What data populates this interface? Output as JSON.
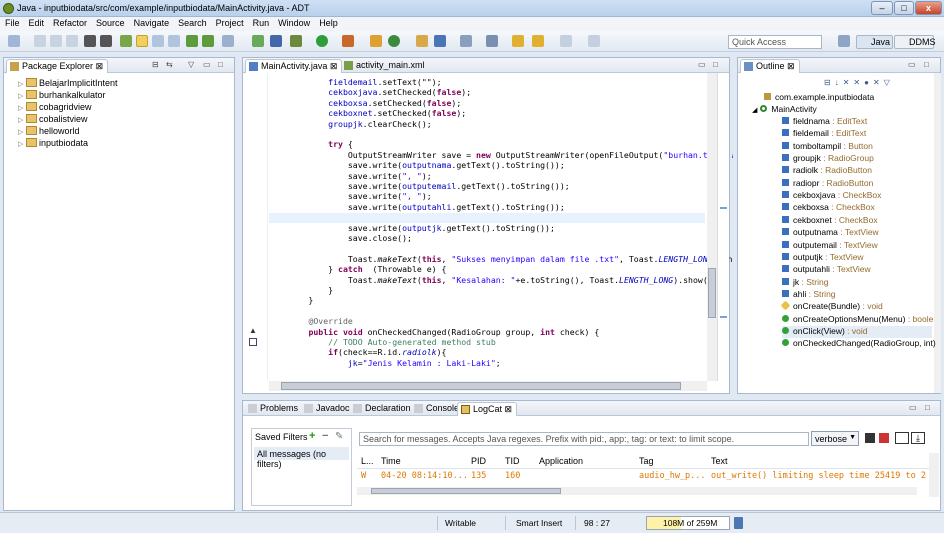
{
  "window": {
    "title": "Java - inputbiodata/src/com/example/inputbiodata/MainActivity.java - ADT",
    "min": "–",
    "max": "□",
    "close": "x"
  },
  "menu": [
    "File",
    "Edit",
    "Refactor",
    "Source",
    "Navigate",
    "Search",
    "Project",
    "Run",
    "Window",
    "Help"
  ],
  "toolbar": {
    "quick_access_placeholder": "Quick Access",
    "java_perspective": "Java",
    "ddms_perspective": "DDMS"
  },
  "package_explorer": {
    "tab": "Package Explorer",
    "projects": [
      "BelajarImplicitIntent",
      "burhankalkulator",
      "cobagridview",
      "cobalistview",
      "helloworld",
      "inputbiodata"
    ]
  },
  "editor": {
    "tabs": [
      "MainActivity.java",
      "activity_main.xml"
    ],
    "lines": [
      [
        [
          "",
          "            "
        ],
        [
          "fld",
          "fieldemail"
        ],
        [
          "",
          ".setText(\"\");"
        ]
      ],
      [
        [
          "",
          "            "
        ],
        [
          "fld",
          "cekboxjava"
        ],
        [
          "",
          ".setChecked("
        ],
        [
          "kw",
          "false"
        ],
        [
          "",
          ");"
        ]
      ],
      [
        [
          "",
          "            "
        ],
        [
          "fld",
          "cekboxsa"
        ],
        [
          "",
          ".setChecked("
        ],
        [
          "kw",
          "false"
        ],
        [
          "",
          ");"
        ]
      ],
      [
        [
          "",
          "            "
        ],
        [
          "fld",
          "cekboxnet"
        ],
        [
          "",
          ".setChecked("
        ],
        [
          "kw",
          "false"
        ],
        [
          "",
          ");"
        ]
      ],
      [
        [
          "",
          "            "
        ],
        [
          "fld",
          "groupjk"
        ],
        [
          "",
          ".clearCheck();"
        ]
      ],
      [
        [
          "",
          ""
        ]
      ],
      [
        [
          "",
          "            "
        ],
        [
          "kw",
          "try"
        ],
        [
          "",
          " {"
        ]
      ],
      [
        [
          "",
          "                OutputStreamWriter save = "
        ],
        [
          "kw",
          "new"
        ],
        [
          "",
          " OutputStreamWriter(openFileOutput("
        ],
        [
          "str",
          "\"burhan.txt\""
        ],
        [
          "",
          ", "
        ],
        [
          "fld ital",
          "M"
        ]
      ],
      [
        [
          "",
          "                save.write("
        ],
        [
          "fld",
          "outputnama"
        ],
        [
          "",
          ".getText().toString());"
        ]
      ],
      [
        [
          "",
          "                save.write("
        ],
        [
          "str",
          "\", \""
        ],
        [
          "",
          ");"
        ]
      ],
      [
        [
          "",
          "                save.write("
        ],
        [
          "fld",
          "outputemail"
        ],
        [
          "",
          ".getText().toString());"
        ]
      ],
      [
        [
          "",
          "                save.write("
        ],
        [
          "str",
          "\", \""
        ],
        [
          "",
          ");"
        ]
      ],
      [
        [
          "",
          "                save.write("
        ],
        [
          "fld",
          "outputahli"
        ],
        [
          "",
          ".getText().toString());"
        ]
      ],
      [
        [
          "",
          "                save.write("
        ],
        [
          "str",
          "\", \""
        ],
        [
          "",
          ");"
        ]
      ],
      [
        [
          "",
          "                save.write("
        ],
        [
          "fld",
          "outputjk"
        ],
        [
          "",
          ".getText().toString());"
        ]
      ],
      [
        [
          "",
          "                save.close();"
        ]
      ],
      [
        [
          "",
          ""
        ]
      ],
      [
        [
          "",
          "                Toast."
        ],
        [
          "ital",
          "makeText"
        ],
        [
          "",
          "("
        ],
        [
          "kw",
          "this"
        ],
        [
          "",
          ", "
        ],
        [
          "str",
          "\"Sukses menyimpan dalam file .txt\""
        ],
        [
          "",
          ", Toast."
        ],
        [
          "fld ital",
          "LENGTH_LONG"
        ],
        [
          "",
          ").sho"
        ]
      ],
      [
        [
          "",
          "            } "
        ],
        [
          "kw",
          "catch"
        ],
        [
          "",
          "  (Throwable e) {"
        ]
      ],
      [
        [
          "",
          "                Toast."
        ],
        [
          "ital",
          "makeText"
        ],
        [
          "",
          "("
        ],
        [
          "kw",
          "this"
        ],
        [
          "",
          ", "
        ],
        [
          "str",
          "\"Kesalahan: \""
        ],
        [
          "",
          "+e.toString(), Toast."
        ],
        [
          "fld ital",
          "LENGTH_LONG"
        ],
        [
          "",
          ").show();"
        ]
      ],
      [
        [
          "",
          "            }"
        ]
      ],
      [
        [
          "",
          "        }"
        ]
      ],
      [
        [
          "",
          ""
        ]
      ],
      [
        [
          "",
          "        "
        ],
        [
          "ann",
          "@Override"
        ]
      ],
      [
        [
          "",
          "        "
        ],
        [
          "kw",
          "public"
        ],
        [
          "",
          " "
        ],
        [
          "kw",
          "void"
        ],
        [
          "",
          " onCheckedChanged(RadioGroup group, "
        ],
        [
          "kw",
          "int"
        ],
        [
          "",
          " check) {"
        ]
      ],
      [
        [
          "",
          "            "
        ],
        [
          "cmt",
          "// TODO Auto-generated method stub"
        ]
      ],
      [
        [
          "",
          "            "
        ],
        [
          "kw",
          "if"
        ],
        [
          "",
          "(check==R.id."
        ],
        [
          "fld ital",
          "radiolk"
        ],
        [
          "",
          "){"
        ]
      ],
      [
        [
          "",
          "                "
        ],
        [
          "fld",
          "jk"
        ],
        [
          "",
          "="
        ],
        [
          "str",
          "\"Jenis Kelamin : Laki-Laki\""
        ],
        [
          "",
          ";"
        ]
      ]
    ]
  },
  "outline": {
    "tab": "Outline",
    "package": "com.example.inputbiodata",
    "class": "MainActivity",
    "members": [
      {
        "name": "fieldnama",
        "type": "EditText",
        "kind": "field"
      },
      {
        "name": "fieldemail",
        "type": "EditText",
        "kind": "field"
      },
      {
        "name": "tomboltampil",
        "type": "Button",
        "kind": "field"
      },
      {
        "name": "groupjk",
        "type": "RadioGroup",
        "kind": "field"
      },
      {
        "name": "radiolk",
        "type": "RadioButton",
        "kind": "field"
      },
      {
        "name": "radiopr",
        "type": "RadioButton",
        "kind": "field"
      },
      {
        "name": "cekboxjava",
        "type": "CheckBox",
        "kind": "field"
      },
      {
        "name": "cekboxsa",
        "type": "CheckBox",
        "kind": "field"
      },
      {
        "name": "cekboxnet",
        "type": "CheckBox",
        "kind": "field"
      },
      {
        "name": "outputnama",
        "type": "TextView",
        "kind": "field"
      },
      {
        "name": "outputemail",
        "type": "TextView",
        "kind": "field"
      },
      {
        "name": "outputjk",
        "type": "TextView",
        "kind": "field"
      },
      {
        "name": "outputahli",
        "type": "TextView",
        "kind": "field"
      },
      {
        "name": "jk",
        "type": "String",
        "kind": "field"
      },
      {
        "name": "ahli",
        "type": "String",
        "kind": "field"
      },
      {
        "name": "onCreate(Bundle)",
        "type": "void",
        "kind": "method-prot"
      },
      {
        "name": "onCreateOptionsMenu(Menu)",
        "type": "boole",
        "kind": "method"
      },
      {
        "name": "onClick(View)",
        "type": "void",
        "kind": "method",
        "selected": true
      },
      {
        "name": "onCheckedChanged(RadioGroup, int)",
        "type": "",
        "kind": "method"
      }
    ]
  },
  "bottom": {
    "tabs": [
      "Problems",
      "Javadoc",
      "Declaration",
      "Console",
      "LogCat"
    ],
    "saved_filters_label": "Saved Filters",
    "all_messages": "All messages (no filters)",
    "search_placeholder": "Search for messages. Accepts Java regexes. Prefix with pid:, app:, tag: or text: to limit scope.",
    "level_value": "verbose",
    "columns": [
      "L...",
      "Time",
      "PID",
      "TID",
      "Application",
      "Tag",
      "Text"
    ],
    "rows": [
      {
        "level": "W",
        "time": "04-20 08:14:10...",
        "pid": "135",
        "tid": "160",
        "app": "",
        "tag": "audio_hw_p...",
        "text": "out_write() limiting sleep time 25419 to 2"
      }
    ]
  },
  "status": {
    "mode": "Writable",
    "insert": "Smart Insert",
    "position": "98 : 27",
    "heap": "108M of 259M",
    "heap_fraction": 0.417
  }
}
